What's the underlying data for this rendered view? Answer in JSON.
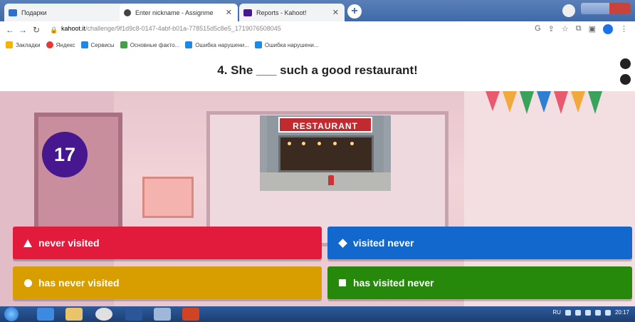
{
  "browser": {
    "tabs": [
      {
        "label": "Подарки",
        "icon": "mail-icon",
        "color": "#2f6fcf"
      },
      {
        "label": "Enter nickname - Assignme",
        "icon": "kahoot-icon",
        "color": "#444444"
      },
      {
        "label": "Reports - Kahoot!",
        "icon": "kahoot-icon",
        "color": "#46178f"
      }
    ],
    "url_host": "kahoot.it",
    "url_path": "/challenge/9f1d9c8-0147-4abf-b01a-778515d5c8e5_1719076508045",
    "bookmarks": [
      "Закладки",
      "Яндекс",
      "Сервисы",
      "Основные факто...",
      "Ошибка нарушени...",
      "Ошибка нарушени..."
    ]
  },
  "question": {
    "text": "4. She ___ such a good restaurant!"
  },
  "timer": {
    "value": "17"
  },
  "image": {
    "sign_text": "RESTAURANT"
  },
  "answers": [
    {
      "label": "never visited",
      "shape": "triangle-icon",
      "color": "#e21b3c"
    },
    {
      "label": "visited never",
      "shape": "diamond-icon",
      "color": "#1368ce"
    },
    {
      "label": "has never visited",
      "shape": "circle-icon",
      "color": "#d89e00"
    },
    {
      "label": "has visited never",
      "shape": "square-icon",
      "color": "#26890c"
    }
  ],
  "taskbar": {
    "lang": "RU",
    "time": "20:17"
  }
}
